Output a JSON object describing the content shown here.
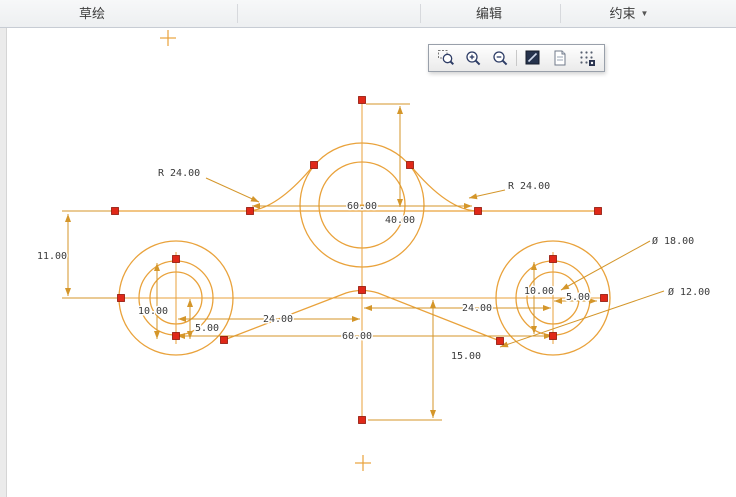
{
  "menu_bar": {
    "tabs": [
      {
        "id": "sketch",
        "label": "草绘"
      },
      {
        "id": "edit",
        "label": "编辑"
      },
      {
        "id": "constraint",
        "label": "约束"
      }
    ]
  },
  "view_toolbar": {
    "icons": [
      {
        "name": "zoom-window-icon"
      },
      {
        "name": "zoom-in-icon"
      },
      {
        "name": "zoom-out-icon"
      },
      {
        "name": "refit-icon"
      },
      {
        "name": "sheet-icon"
      },
      {
        "name": "grid-dots-icon"
      }
    ]
  },
  "sketch": {
    "colors": {
      "geometry": "#E9A23B",
      "dimension": "#D4962A",
      "vertex": "#E02818",
      "dim_text": "#3A3A3A"
    },
    "dims": {
      "radius_left": "R 24.00",
      "radius_right": "R 24.00",
      "top_width": "60.00",
      "center_height": "40.00",
      "left_height": "11.00",
      "left_offset_10": "10.00",
      "left_offset_5": "5.00",
      "left_spacing_24": "24.00",
      "bottom_width_60": "60.00",
      "bottom_height_15": "15.00",
      "right_spacing_24": "24.00",
      "right_offset_10": "10.00",
      "right_offset_5": "5.00",
      "diameter_18": "Ø 18.00",
      "diameter_12": "Ø 12.00"
    }
  }
}
